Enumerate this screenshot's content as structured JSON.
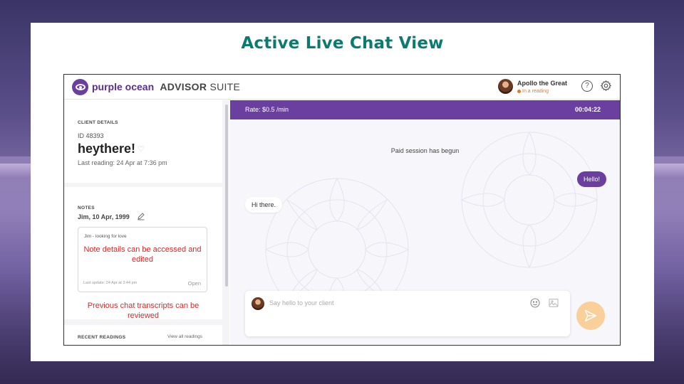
{
  "slide": {
    "title": "Active Live Chat View"
  },
  "header": {
    "brand": "purple ocean",
    "brand_suffix_bold": "ADVISOR",
    "brand_suffix": "SUITE",
    "user_name": "Apollo the Great",
    "user_status": "In a reading",
    "help_label": "?"
  },
  "sidebar": {
    "client_details_label": "CLIENT DETAILS",
    "client_id": "ID 48393",
    "client_name": "heythere!",
    "last_reading": "Last reading: 24 Apr at 7:36 pm",
    "notes_label": "NOTES",
    "note_title": "Jim, 10 Apr, 1999",
    "note_text": "Jim - looking for love",
    "note_annotation": "Note details can be accessed and edited",
    "note_last_update": "Last update: 24 Apr at 3:44 pm",
    "note_open": "Open",
    "transcript_annotation": "Previous chat transcripts can be reviewed",
    "recent_label": "RECENT READINGS",
    "view_all": "View all readings"
  },
  "chat": {
    "rate": "Rate: $0.5 /min",
    "timer": "00:04:22",
    "system_message": "Paid session has begun",
    "outgoing_message": "Hello!",
    "incoming_message": "Hi there.",
    "input_placeholder": "Say hello to your client"
  },
  "colors": {
    "brand_purple": "#6b3fa0",
    "title_teal": "#0d7a70",
    "annotation_red": "#d42a2a",
    "send_button": "#f9cf9a",
    "status_orange": "#e07b2a"
  },
  "icons": [
    "eye-logo-icon",
    "help-icon",
    "gear-icon",
    "heart-icon",
    "pencil-icon",
    "emoji-icon",
    "image-icon",
    "send-icon"
  ]
}
